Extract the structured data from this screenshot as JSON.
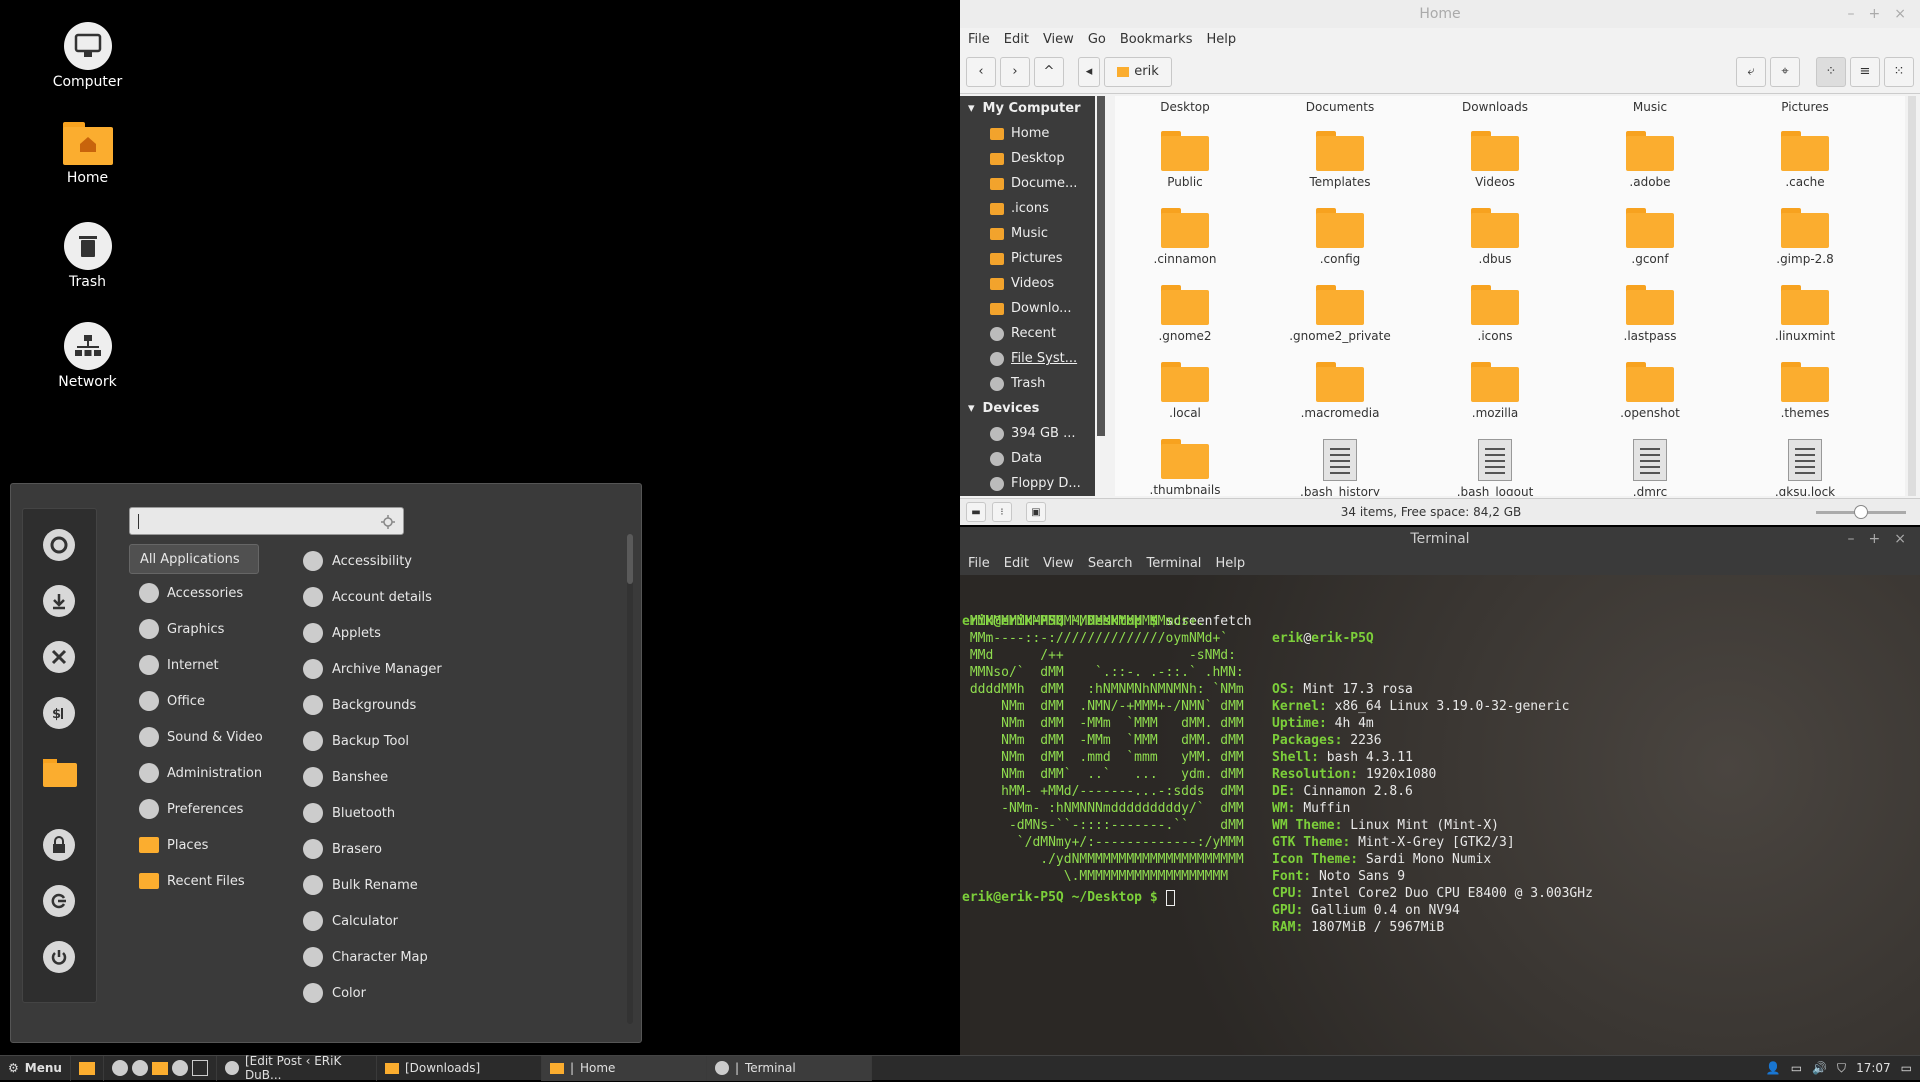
{
  "desktop": {
    "icons": [
      {
        "label": "Computer"
      },
      {
        "label": "Home"
      },
      {
        "label": "Trash"
      },
      {
        "label": "Network"
      }
    ]
  },
  "menu": {
    "search": {
      "value": "",
      "placeholder": ""
    },
    "categories": [
      {
        "label": "All Applications",
        "selected": true
      },
      {
        "label": "Accessories"
      },
      {
        "label": "Graphics"
      },
      {
        "label": "Internet"
      },
      {
        "label": "Office"
      },
      {
        "label": "Sound & Video"
      },
      {
        "label": "Administration"
      },
      {
        "label": "Preferences"
      },
      {
        "label": "Places"
      },
      {
        "label": "Recent Files"
      }
    ],
    "apps": [
      {
        "label": "Accessibility"
      },
      {
        "label": "Account details"
      },
      {
        "label": "Applets"
      },
      {
        "label": "Archive Manager"
      },
      {
        "label": "Backgrounds"
      },
      {
        "label": "Backup Tool"
      },
      {
        "label": "Banshee"
      },
      {
        "label": "Bluetooth"
      },
      {
        "label": "Brasero"
      },
      {
        "label": "Bulk Rename"
      },
      {
        "label": "Calculator"
      },
      {
        "label": "Character Map"
      },
      {
        "label": "Color"
      }
    ]
  },
  "taskbar": {
    "menu_label": "Menu",
    "windows": [
      {
        "label": "[Edit Post ‹ ERiK DuB..."
      },
      {
        "label": "[Downloads]"
      },
      {
        "label": "Home"
      },
      {
        "label": "Terminal"
      }
    ],
    "clock": "17:07"
  },
  "file_manager": {
    "title": "Home",
    "menu": [
      "File",
      "Edit",
      "View",
      "Go",
      "Bookmarks",
      "Help"
    ],
    "path_button": "erik",
    "column_headers": [
      "Desktop",
      "Documents",
      "Downloads",
      "Music",
      "Pictures"
    ],
    "sidebar": {
      "my_computer": "My Computer",
      "places": [
        "Home",
        "Desktop",
        "Docume...",
        ".icons",
        "Music",
        "Pictures",
        "Videos",
        "Downlo...",
        "Recent",
        "File Syst...",
        "Trash"
      ],
      "devices": "Devices",
      "device_items": [
        "394 GB ...",
        "Data",
        "Floppy D..."
      ]
    },
    "items": [
      {
        "name": "Public",
        "type": "folder"
      },
      {
        "name": "Templates",
        "type": "folder"
      },
      {
        "name": "Videos",
        "type": "folder"
      },
      {
        "name": ".adobe",
        "type": "folder"
      },
      {
        "name": ".cache",
        "type": "folder"
      },
      {
        "name": ".cinnamon",
        "type": "folder"
      },
      {
        "name": ".config",
        "type": "folder"
      },
      {
        "name": ".dbus",
        "type": "folder"
      },
      {
        "name": ".gconf",
        "type": "folder"
      },
      {
        "name": ".gimp-2.8",
        "type": "folder"
      },
      {
        "name": ".gnome2",
        "type": "folder"
      },
      {
        "name": ".gnome2_private",
        "type": "folder"
      },
      {
        "name": ".icons",
        "type": "folder"
      },
      {
        "name": ".lastpass",
        "type": "folder"
      },
      {
        "name": ".linuxmint",
        "type": "folder"
      },
      {
        "name": ".local",
        "type": "folder"
      },
      {
        "name": ".macromedia",
        "type": "folder"
      },
      {
        "name": ".mozilla",
        "type": "folder"
      },
      {
        "name": ".openshot",
        "type": "folder"
      },
      {
        "name": ".themes",
        "type": "folder"
      },
      {
        "name": ".thumbnails",
        "type": "folder"
      },
      {
        "name": ".bash_history",
        "type": "file"
      },
      {
        "name": ".bash_logout",
        "type": "file"
      },
      {
        "name": ".dmrc",
        "type": "file"
      },
      {
        "name": ".gksu.lock",
        "type": "file"
      }
    ],
    "status": "34 items, Free space: 84,2 GB"
  },
  "terminal": {
    "title": "Terminal",
    "menu": [
      "File",
      "Edit",
      "View",
      "Search",
      "Terminal",
      "Help"
    ],
    "prompt": "erik@erik-P5Q ~/Desktop $",
    "command": "screenfetch",
    "logo": [
      " MMMMMMMMMMMMMMMMMMMMMMMMMmds+.",
      " MMm----::-://////////////oymNMd+`",
      " MMd      /++                -sNMd:",
      " MMNso/`  dMM    `.::-. .-::.` .hMN:",
      " ddddMMh  dMM   :hNMNMNhNMNMNh: `NMm",
      "     NMm  dMM  .NMN/-+MMM+-/NMN` dMM",
      "     NMm  dMM  -MMm  `MMM   dMM. dMM",
      "     NMm  dMM  -MMm  `MMM   dMM. dMM",
      "     NMm  dMM  .mmd  `mmm   yMM. dMM",
      "     NMm  dMM`  ..`   ...   ydm. dMM",
      "     hMM- +MMd/-------...-:sdds  dMM",
      "     -NMm- :hNMNNNmdddddddddy/`  dMM",
      "      -dMNs-``-::::-------.``    dMM",
      "       `/dMNmy+/:-------------:/yMMM",
      "          ./ydNMMMMMMMMMMMMMMMMMMMMM",
      "             \\.MMMMMMMMMMMMMMMMMMM"
    ],
    "info_header": {
      "user": "erik",
      "at": "@",
      "host": "erik-P5Q"
    },
    "info": [
      {
        "k": "OS:",
        "v": "Mint 17.3 rosa"
      },
      {
        "k": "Kernel:",
        "v": "x86_64 Linux 3.19.0-32-generic"
      },
      {
        "k": "Uptime:",
        "v": "4h 4m"
      },
      {
        "k": "Packages:",
        "v": "2236"
      },
      {
        "k": "Shell:",
        "v": "bash 4.3.11"
      },
      {
        "k": "Resolution:",
        "v": "1920x1080"
      },
      {
        "k": "DE:",
        "v": "Cinnamon 2.8.6"
      },
      {
        "k": "WM:",
        "v": "Muffin"
      },
      {
        "k": "WM Theme:",
        "v": "Linux Mint (Mint-X)"
      },
      {
        "k": "GTK Theme:",
        "v": "Mint-X-Grey [GTK2/3]"
      },
      {
        "k": "Icon Theme:",
        "v": "Sardi Mono Numix"
      },
      {
        "k": "Font:",
        "v": "Noto Sans 9"
      },
      {
        "k": "CPU:",
        "v": "Intel Core2 Duo CPU E8400 @ 3.003GHz"
      },
      {
        "k": "GPU:",
        "v": "Gallium 0.4 on NV94"
      },
      {
        "k": "RAM:",
        "v": "1807MiB / 5967MiB"
      }
    ]
  },
  "colors": {
    "folder": "#fbad2f",
    "terminal_green": "#8fdc4f",
    "sidebar_bg": "#3b3b3b"
  }
}
